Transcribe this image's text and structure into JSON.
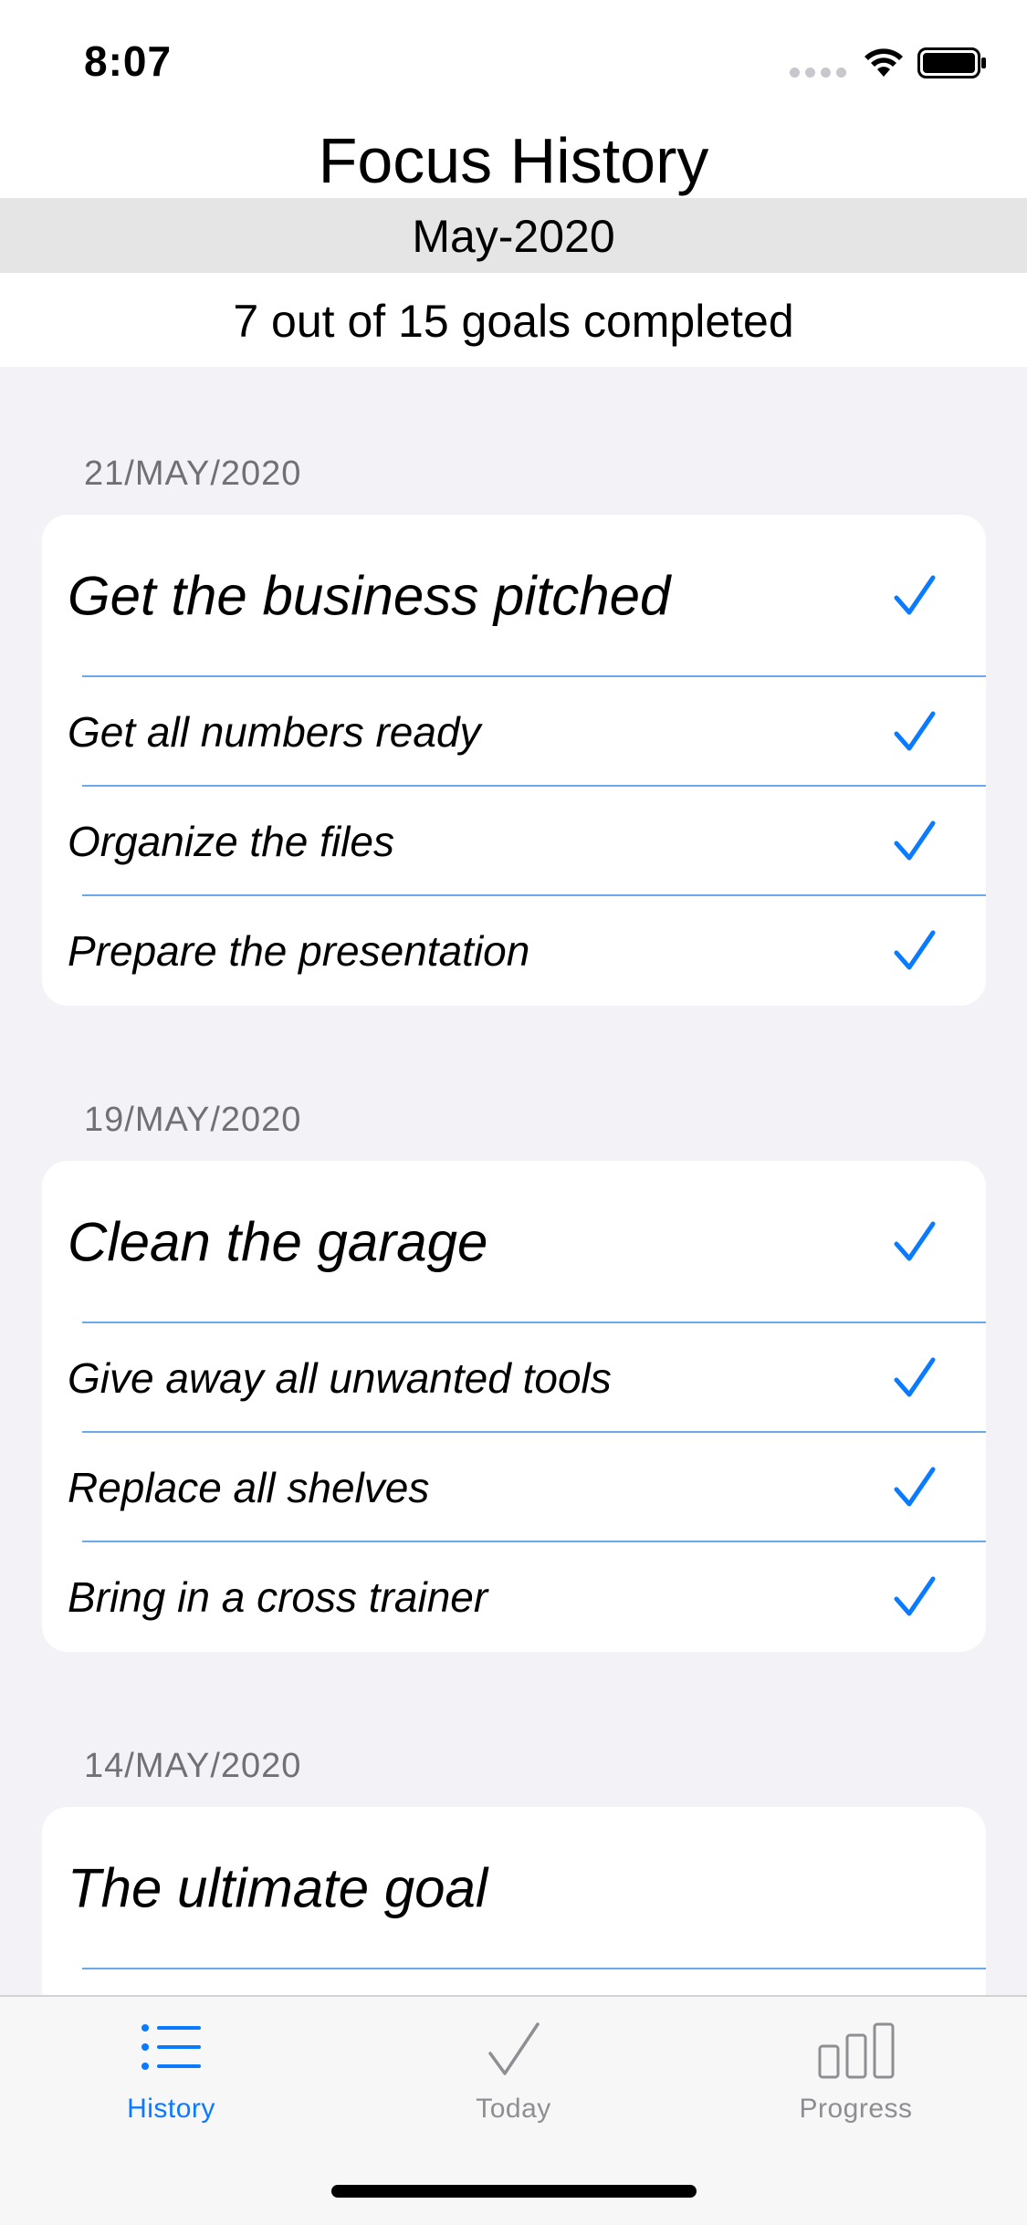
{
  "status_bar": {
    "time": "8:07"
  },
  "header": {
    "title": "Focus History",
    "month": "May-2020",
    "summary": "7 out of 15 goals completed"
  },
  "colors": {
    "accent": "#0a7aff",
    "inactive": "#8e8e93",
    "divider": "#6aa9ec"
  },
  "sections": [
    {
      "date": "21/MAY/2020",
      "goal": {
        "title": "Get the business pitched",
        "completed": true
      },
      "tasks": [
        {
          "title": "Get all numbers ready",
          "completed": true
        },
        {
          "title": "Organize the files",
          "completed": true
        },
        {
          "title": "Prepare the presentation",
          "completed": true
        }
      ]
    },
    {
      "date": "19/MAY/2020",
      "goal": {
        "title": "Clean the garage",
        "completed": true
      },
      "tasks": [
        {
          "title": "Give away all unwanted tools",
          "completed": true
        },
        {
          "title": "Replace all shelves",
          "completed": true
        },
        {
          "title": "Bring in a cross trainer",
          "completed": true
        }
      ]
    },
    {
      "date": "14/MAY/2020",
      "goal": {
        "title": "The ultimate goal",
        "completed": false
      },
      "tasks": []
    }
  ],
  "tabs": [
    {
      "label": "History",
      "icon": "list-icon",
      "active": true
    },
    {
      "label": "Today",
      "icon": "check-icon",
      "active": false
    },
    {
      "label": "Progress",
      "icon": "bar-chart-icon",
      "active": false
    }
  ]
}
